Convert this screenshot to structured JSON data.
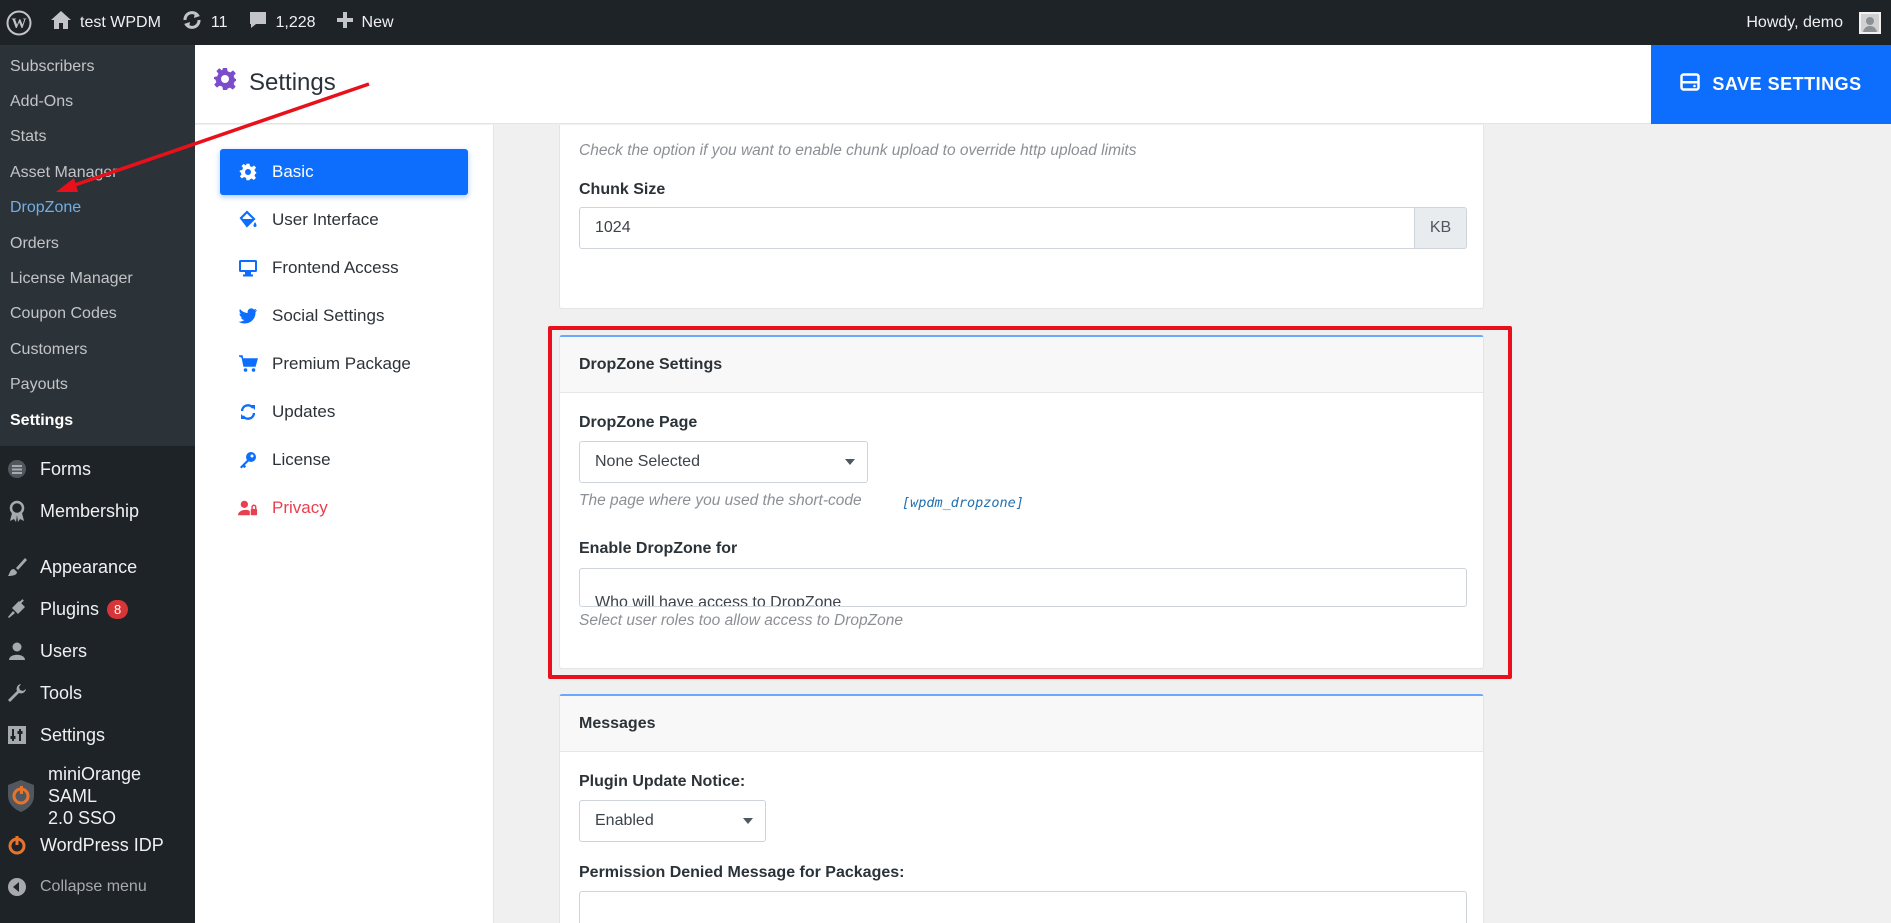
{
  "adminbar": {
    "site_name": "test WPDM",
    "updates_count": "11",
    "comments_count": "1,228",
    "new_label": "New",
    "howdy": "Howdy, demo"
  },
  "submenu": [
    {
      "label": "Subscribers"
    },
    {
      "label": "Add-Ons"
    },
    {
      "label": "Stats"
    },
    {
      "label": "Asset Manager"
    },
    {
      "label": "DropZone"
    },
    {
      "label": "Orders"
    },
    {
      "label": "License Manager"
    },
    {
      "label": "Coupon Codes"
    },
    {
      "label": "Customers"
    },
    {
      "label": "Payouts"
    },
    {
      "label": "Settings"
    }
  ],
  "menu": {
    "forms": "Forms",
    "membership": "Membership",
    "appearance": "Appearance",
    "plugins": "Plugins",
    "plugins_badge": "8",
    "users": "Users",
    "tools": "Tools",
    "settings": "Settings",
    "miniorange_line1": "miniOrange SAML",
    "miniorange_line2": "2.0 SSO",
    "wordpress_idp": "WordPress IDP",
    "collapse": "Collapse menu"
  },
  "header": {
    "title": "Settings",
    "save_label": "SAVE SETTINGS"
  },
  "settings_nav": [
    {
      "label": "Basic",
      "icon": "gear-icon"
    },
    {
      "label": "User Interface",
      "icon": "paint-bucket-icon"
    },
    {
      "label": "Frontend Access",
      "icon": "desktop-icon"
    },
    {
      "label": "Social Settings",
      "icon": "twitter-icon"
    },
    {
      "label": "Premium Package",
      "icon": "cart-icon"
    },
    {
      "label": "Updates",
      "icon": "sync-icon"
    },
    {
      "label": "License",
      "icon": "key-icon"
    },
    {
      "label": "Privacy",
      "icon": "user-lock-icon"
    }
  ],
  "chunk": {
    "hint": "Check the option if you want to enable chunk upload to override http upload limits",
    "size_label": "Chunk Size",
    "size_value": "1024",
    "size_unit": "KB"
  },
  "dropzone": {
    "heading": "DropZone Settings",
    "page_label": "DropZone Page",
    "page_value": "None Selected",
    "page_hint": "The page where you used the short-code",
    "shortcode": "[wpdm_dropzone]",
    "enable_label": "Enable DropZone for",
    "enable_placeholder": "Who will have access to DropZone",
    "enable_hint": "Select user roles too allow access to DropZone"
  },
  "messages": {
    "heading": "Messages",
    "update_notice_label": "Plugin Update Notice:",
    "update_notice_value": "Enabled",
    "permission_label": "Permission Denied Message for Packages:"
  },
  "colors": {
    "accent": "#0d6efd",
    "admin_dark": "#1d2327",
    "annotation_red": "#e8101a",
    "privacy_red": "#e8404f"
  }
}
